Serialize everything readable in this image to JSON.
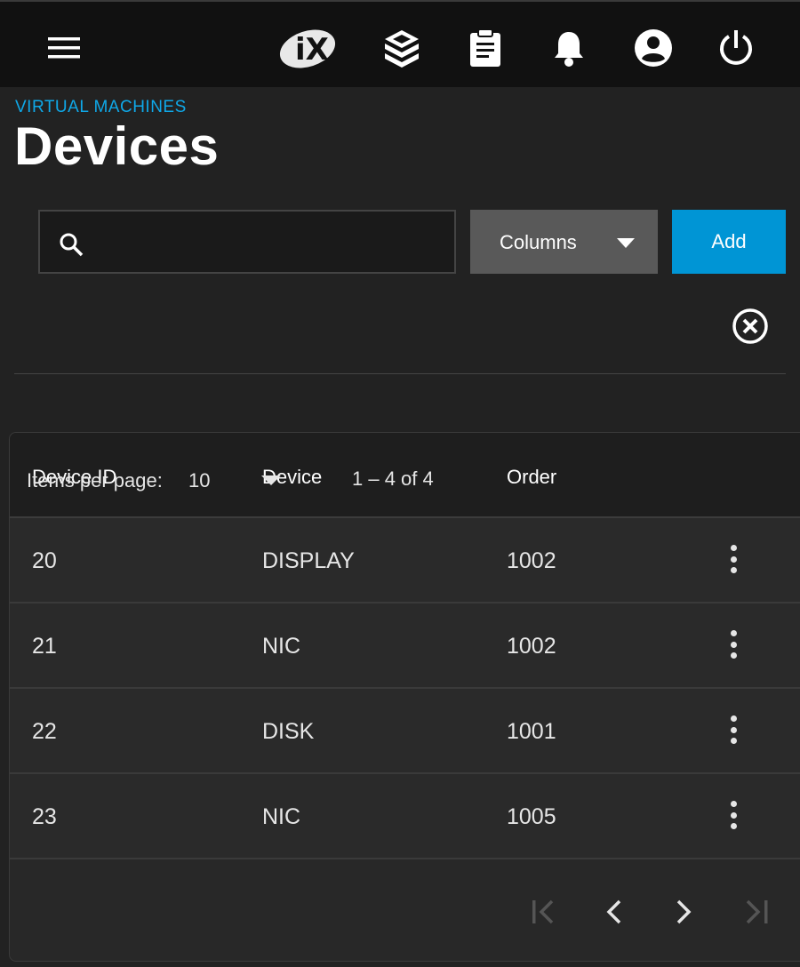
{
  "header": {
    "icons": [
      "menu-icon",
      "ix-logo-icon",
      "truecommand-icon",
      "task-manager-icon",
      "bell-icon",
      "account-icon",
      "power-icon"
    ]
  },
  "breadcrumb": "VIRTUAL MACHINES",
  "page_title": "Devices",
  "toolbar": {
    "search_placeholder": "",
    "columns_label": "Columns",
    "add_label": "Add"
  },
  "table": {
    "headers": [
      "Device ID",
      "Device",
      "Order"
    ],
    "rows": [
      {
        "id": "20",
        "device": "DISPLAY",
        "order": "1002"
      },
      {
        "id": "21",
        "device": "NIC",
        "order": "1002"
      },
      {
        "id": "22",
        "device": "DISK",
        "order": "1001"
      },
      {
        "id": "23",
        "device": "NIC",
        "order": "1005"
      }
    ]
  },
  "paginator": {
    "items_per_page_label": "Items per page:",
    "page_size": "10",
    "range_label": "1 – 4 of 4"
  },
  "colors": {
    "accent": "#0095d5",
    "breadcrumb": "#0fa8e8",
    "background": "#222222",
    "topbar": "#111111"
  }
}
